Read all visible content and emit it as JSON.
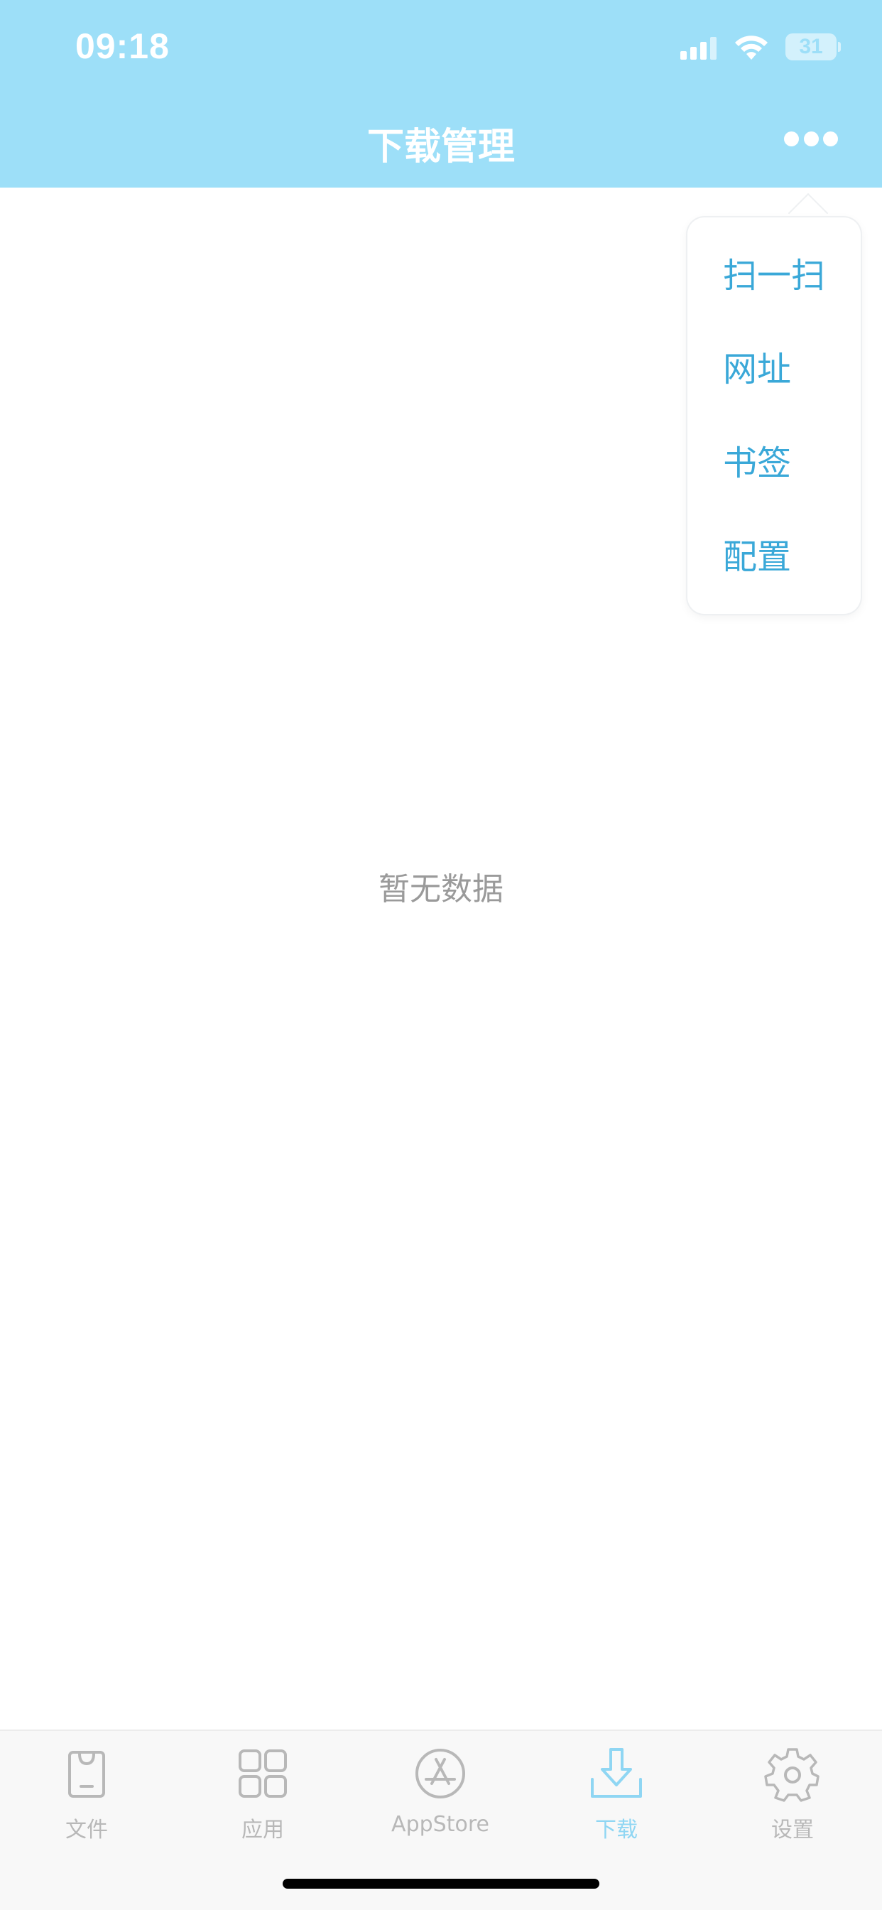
{
  "status": {
    "time": "09:18",
    "battery": "31"
  },
  "header": {
    "title": "下载管理",
    "more_icon": "more-horizontal-icon"
  },
  "menu": {
    "items": [
      {
        "label": "扫一扫"
      },
      {
        "label": "网址"
      },
      {
        "label": "书签"
      },
      {
        "label": "配置"
      }
    ]
  },
  "empty": {
    "text": "暂无数据"
  },
  "tabbar": {
    "items": [
      {
        "label": "文件",
        "icon": "file-bag-icon",
        "active": false
      },
      {
        "label": "应用",
        "icon": "grid-apps-icon",
        "active": false
      },
      {
        "label": "AppStore",
        "icon": "appstore-icon",
        "active": false
      },
      {
        "label": "下载",
        "icon": "download-icon",
        "active": true
      },
      {
        "label": "设置",
        "icon": "gear-icon",
        "active": false
      }
    ]
  },
  "colors": {
    "header_bg": "#9ddff8",
    "menu_text": "#3aa8d8",
    "tab_inactive": "#b8b8b8",
    "tab_active": "#8fd6f3"
  }
}
